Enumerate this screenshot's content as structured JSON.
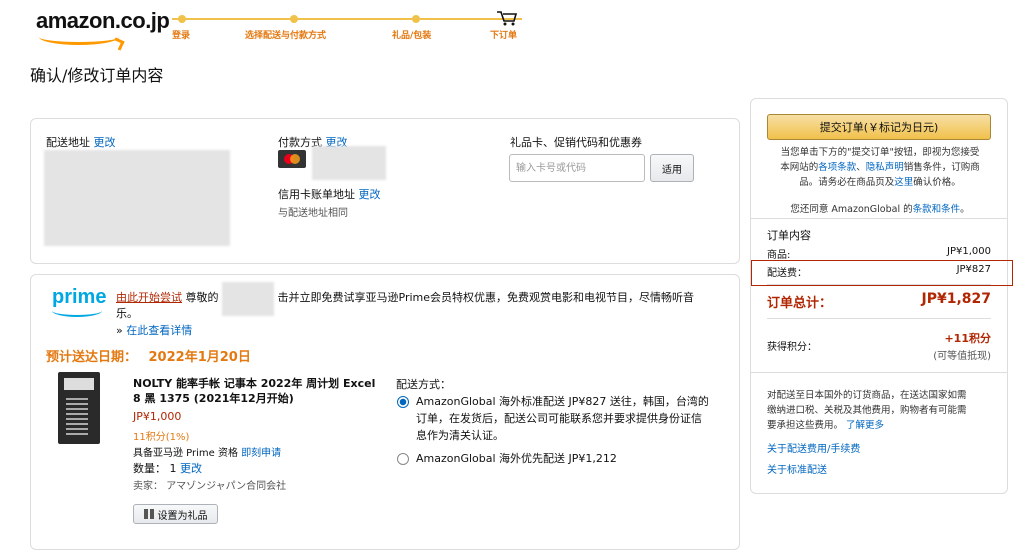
{
  "header": {
    "logo": "amazon.co.jp",
    "steps": [
      "登录",
      "选择配送与付款方式",
      "礼品/包装",
      "下订单"
    ]
  },
  "page_title": "确认/修改订单内容",
  "shipping": {
    "label": "配送地址",
    "change": "更改"
  },
  "payment": {
    "label": "付款方式",
    "change": "更改",
    "billing_label": "信用卡账单地址",
    "billing_change": "更改",
    "billing_note": "与配送地址相同"
  },
  "giftcard": {
    "label": "礼品卡、促销代码和优惠券",
    "placeholder": "输入卡号或代码",
    "apply": "适用"
  },
  "prime": {
    "logo": "prime",
    "link": "由此开始尝试",
    "text_before": "尊敬的",
    "text_after": "击并立即免费试享亚马逊Prime会员特权优惠，免费观赏电影和电视节目，尽情畅听音",
    "text_line2": "乐。",
    "details": "在此查看详情"
  },
  "delivery": {
    "label": "预计送达日期：",
    "date": "2022年1月20日"
  },
  "item": {
    "title_line1": "NOLTY 能率手帐 记事本 2022年 周计划 Excel",
    "title_line2": "8 黑 1375 (2021年12月开始)",
    "price": "JP¥1,000",
    "points": "11积分(1%)",
    "prime_text": "具备亚马逊 Prime 资格",
    "prime_link": "即刻申请",
    "qty_label": "数量：",
    "qty": "1",
    "qty_change": "更改",
    "seller_label": "卖家：",
    "seller": "アマゾンジャパン合同会社",
    "gift_button": "设置为礼品"
  },
  "shipping_method": {
    "label": "配送方式：",
    "options": [
      {
        "line1": "AmazonGlobal 海外标准配送 JP¥827 送往，韩国，台湾的",
        "line2": "订单，在发货后，配送公司可能联系您并要求提供身份证信",
        "line3": "息作为清关认证。",
        "checked": true
      },
      {
        "line1": "AmazonGlobal 海外优先配送 JP¥1,212",
        "checked": false
      }
    ]
  },
  "summary": {
    "place_order": "提交订单(￥标记为日元)",
    "note1_a": "当您单击下方的\"提交订单\"按钮，即视为您接受",
    "note1_b": "本网站的",
    "note1_link1": "各项条款",
    "note1_sep": "、",
    "note1_link2": "隐私声明",
    "note1_c": "销售条件，订购商",
    "note1_d": "品。请务必在商品页及",
    "note1_link3": "这里",
    "note1_e": "确认价格。",
    "note2_a": "您还同意 AmazonGlobal 的",
    "note2_link": "条款和条件",
    "note2_b": "。",
    "contents_label": "订单内容",
    "items_label": "商品:",
    "items_value": "JP¥1,000",
    "shipping_label": "配送费：",
    "shipping_value": "JP¥827",
    "total_label": "订单总计：",
    "total_value": "JP¥1,827",
    "points_label": "获得积分：",
    "points_value": "+11积分",
    "points_note": "(可等值抵现)",
    "import_note_1": "对配送至日本国外的订货商品，在送达国家如需",
    "import_note_2": "缴纳进口税、关税及其他费用，购物者有可能需",
    "import_note_3": "要承担这些费用。",
    "import_link": "了解更多",
    "link_fees": "关于配送费用/手续费",
    "link_standard": "关于标准配送"
  }
}
